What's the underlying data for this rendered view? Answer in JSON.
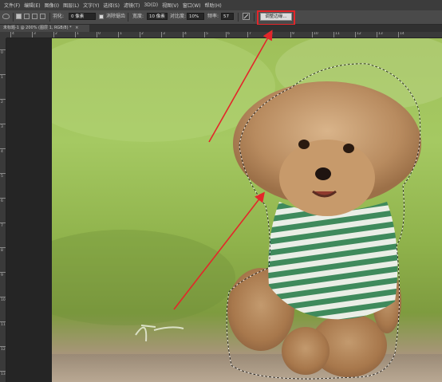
{
  "menu": {
    "items": [
      "文件(F)",
      "编辑(E)",
      "图像(I)",
      "图层(L)",
      "文字(Y)",
      "选择(S)",
      "滤镜(T)",
      "3D(D)",
      "视图(V)",
      "窗口(W)",
      "帮助(H)"
    ]
  },
  "options": {
    "feather_label": "羽化:",
    "feather_value": "0 像素",
    "antialias_label": "消除锯齿",
    "width_label": "宽度:",
    "width_value": "10 像素",
    "contrast_label": "对比度:",
    "contrast_value": "10%",
    "frequency_label": "频率:",
    "frequency_value": "57",
    "refine_edge_label": "调整边缘..."
  },
  "document": {
    "tab_title": "未标题-1 @ 200% (图层 1, RGB/8) *",
    "close_glyph": "×"
  },
  "ruler": {
    "top_labels": [
      "4",
      "3",
      "2",
      "1",
      "0",
      "1",
      "2",
      "3",
      "4",
      "5",
      "6",
      "7",
      "8",
      "9",
      "10",
      "11",
      "12",
      "13",
      "14"
    ],
    "left_labels": [
      "0",
      "1",
      "2",
      "3",
      "4",
      "5",
      "6",
      "7",
      "8",
      "9",
      "10",
      "11",
      "12",
      "13"
    ]
  },
  "colors": {
    "highlight": "#e3262a",
    "arrow": "#e3262a"
  },
  "icons": [
    "lasso-tool-icon",
    "new-selection-icon",
    "add-selection-icon",
    "subtract-selection-icon",
    "intersect-selection-icon",
    "pen-pressure-icon"
  ]
}
